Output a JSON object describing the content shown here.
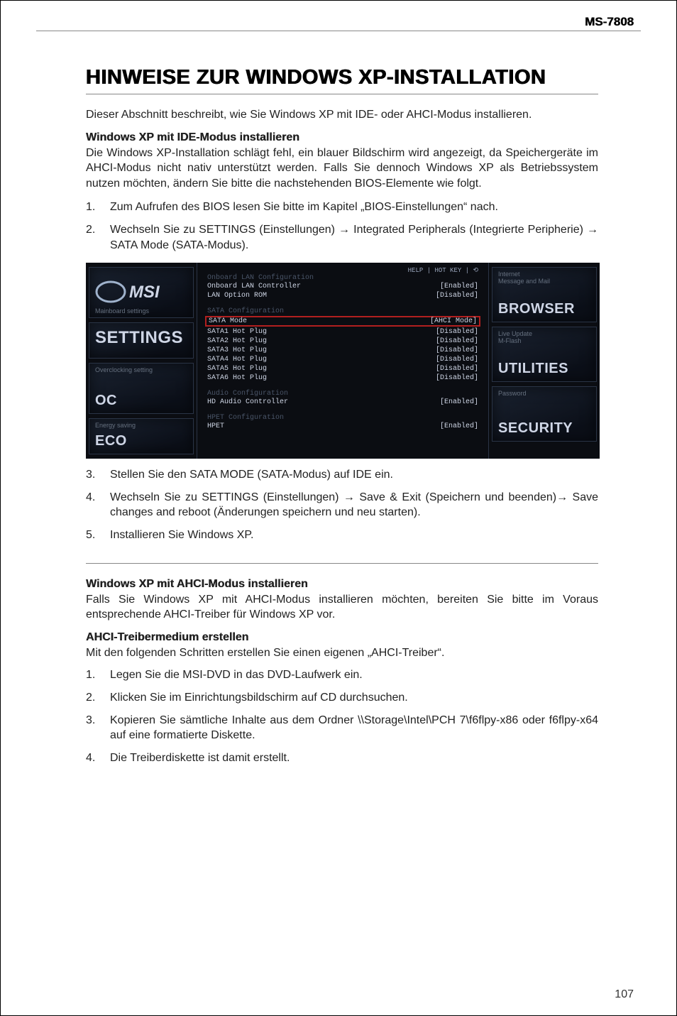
{
  "header": {
    "model": "MS-7808"
  },
  "title": "HINWEISE ZUR WINDOWS XP-INSTALLATION",
  "intro": "Dieser Abschnitt beschreibt, wie Sie Windows XP mit IDE- oder AHCI-Modus installieren.",
  "sec1": {
    "heading": "Windows XP mit IDE-Modus installieren",
    "para": "Die Windows XP-Installation schlägt fehl, ein blauer Bildschirm wird angezeigt, da Speichergeräte im AHCI-Modus nicht nativ unterstützt werden. Falls Sie dennoch Windows XP als Betriebssystem nutzen möchten, ändern Sie bitte die nachstehenden BIOS-Elemente wie folgt.",
    "steps_a": [
      "Zum Aufrufen des BIOS lesen Sie bitte im Kapitel „BIOS-Einstellungen“ nach.",
      "Wechseln Sie zu SETTINGS (Einstellungen) → Integrated Peripherals (Integrierte Peripherie) → SATA Mode (SATA-Modus)."
    ],
    "steps_b": [
      "Stellen Sie den SATA MODE (SATA-Modus) auf IDE ein.",
      "Wechseln Sie zu SETTINGS (Einstellungen) → Save & Exit (Speichern und beenden)→ Save changes and reboot (Änderungen speichern und neu starten).",
      "Installieren Sie Windows XP."
    ]
  },
  "sec2": {
    "heading": "Windows XP mit AHCI-Modus installieren",
    "para": "Falls Sie Windows XP mit AHCI-Modus installieren möchten, bereiten Sie bitte im Voraus entsprechende AHCI-Treiber für Windows XP vor."
  },
  "sec3": {
    "heading": "AHCI-Treibermedium erstellen",
    "para": "Mit den folgenden Schritten erstellen Sie einen eigenen „AHCI-Treiber“.",
    "steps": [
      "Legen Sie die MSI-DVD in das DVD-Laufwerk ein.",
      "Klicken Sie im Einrichtungsbildschirm auf CD durchsuchen.",
      "Kopieren Sie sämtliche Inhalte aus dem Ordner \\\\Storage\\Intel\\PCH 7\\f6flpy-x86 oder f6flpy-x64 auf eine formatierte Diskette.",
      "Die Treiberdiskette ist damit erstellt."
    ]
  },
  "bios": {
    "help_bar": "HELP  |  HOT KEY  |  ⟲",
    "left": [
      {
        "cap": "Mainboard settings",
        "big": "SETTINGS"
      },
      {
        "cap": "Overclocking setting",
        "big": "OC"
      },
      {
        "cap": "Energy saving",
        "big": "ECO"
      }
    ],
    "right": [
      {
        "cap": "Internet\nMessage and Mail",
        "big": "BROWSER"
      },
      {
        "cap": "Live Update\nM-Flash",
        "big": "UTILITIES"
      },
      {
        "cap": "Password",
        "big": "SECURITY"
      }
    ],
    "groups": [
      {
        "title": "Onboard LAN Configuration",
        "rows": [
          {
            "k": "Onboard LAN Controller",
            "v": "[Enabled]"
          },
          {
            "k": "LAN Option ROM",
            "v": "[Disabled]"
          }
        ]
      },
      {
        "title": "SATA Configuration",
        "rows": [
          {
            "k": "SATA Mode",
            "v": "[AHCI Mode]",
            "boxed": true
          },
          {
            "k": "SATA1 Hot Plug",
            "v": "[Disabled]"
          },
          {
            "k": "SATA2 Hot Plug",
            "v": "[Disabled]"
          },
          {
            "k": "SATA3 Hot Plug",
            "v": "[Disabled]"
          },
          {
            "k": "SATA4 Hot Plug",
            "v": "[Disabled]"
          },
          {
            "k": "SATA5 Hot Plug",
            "v": "[Disabled]"
          },
          {
            "k": "SATA6 Hot Plug",
            "v": "[Disabled]"
          }
        ]
      },
      {
        "title": "Audio Configuration",
        "rows": [
          {
            "k": "HD Audio Controller",
            "v": "[Enabled]"
          }
        ]
      },
      {
        "title": "HPET Configuration",
        "rows": [
          {
            "k": "HPET",
            "v": "[Enabled]"
          }
        ]
      }
    ]
  },
  "page_num": "107"
}
